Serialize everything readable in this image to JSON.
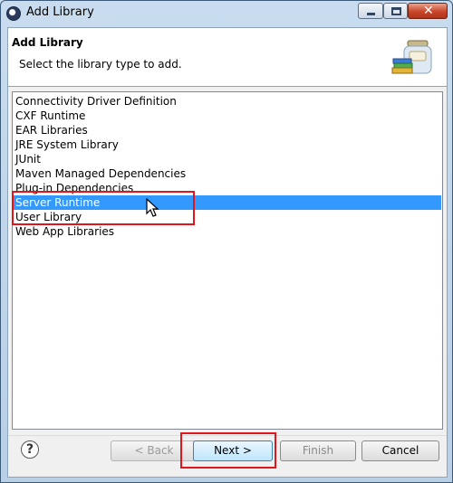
{
  "window": {
    "title": "Add Library"
  },
  "header": {
    "title": "Add Library",
    "description": "Select the library type to add."
  },
  "list": {
    "items": [
      "Connectivity Driver Definition",
      "CXF Runtime",
      "EAR Libraries",
      "JRE System Library",
      "JUnit",
      "Maven Managed Dependencies",
      "Plug-in Dependencies",
      "Server Runtime",
      "User Library",
      "Web App Libraries"
    ],
    "selected": "Server Runtime"
  },
  "buttons": {
    "help": "?",
    "back": "< Back",
    "next": "Next >",
    "finish": "Finish",
    "cancel": "Cancel"
  },
  "colors": {
    "selection": "#3399ff",
    "annotation": "#e0161c"
  },
  "icons": [
    "app-icon",
    "minimize-icon",
    "maximize-icon",
    "close-icon",
    "library-jar-icon",
    "help-icon",
    "mouse-cursor-icon"
  ]
}
